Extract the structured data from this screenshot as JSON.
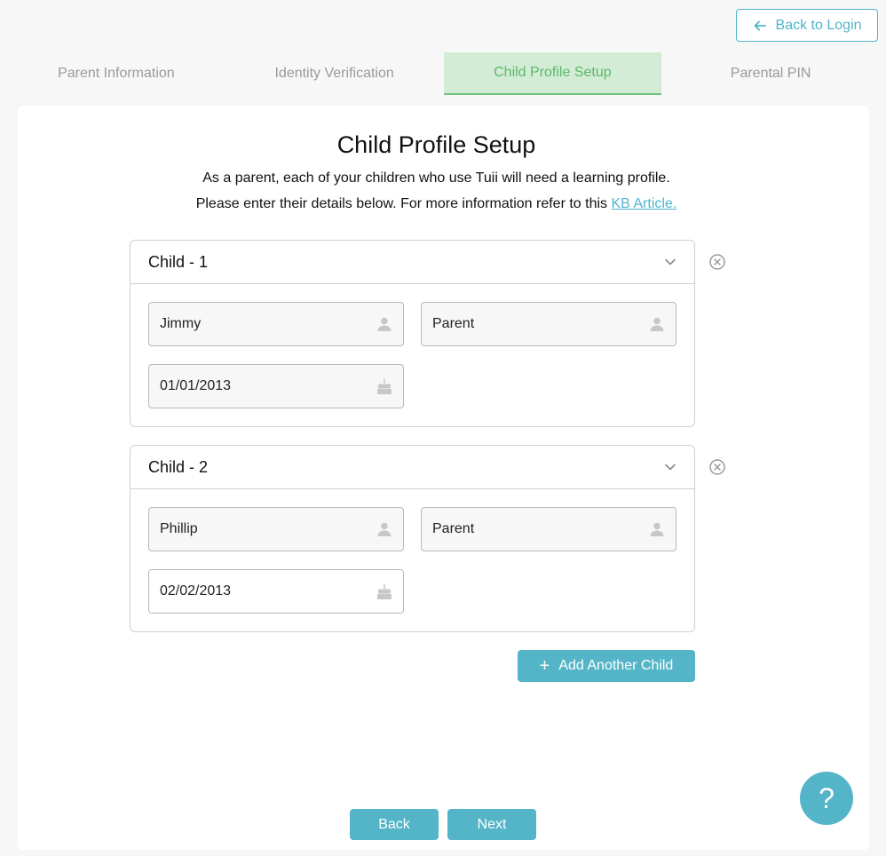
{
  "header": {
    "back_to_login_label": "Back to Login"
  },
  "stepper": {
    "steps": [
      {
        "label": "Parent Information"
      },
      {
        "label": "Identity Verification"
      },
      {
        "label": "Child Profile Setup"
      },
      {
        "label": "Parental PIN"
      }
    ],
    "active_step": "Child Profile Setup"
  },
  "main": {
    "title": "Child Profile Setup",
    "subtitle_line1": "As a parent, each of your children who use Tuii will need a learning profile.",
    "subtitle_line2": "Please enter their details below. For more information refer to this",
    "kb_link_label": "KB Article."
  },
  "children": [
    {
      "header": "Child - 1",
      "first_name": "Jimmy",
      "last_name": "Parent",
      "dob": "01/01/2013"
    },
    {
      "header": "Child - 2",
      "first_name": "Phillip",
      "last_name": "Parent",
      "dob": "02/02/2013"
    }
  ],
  "actions": {
    "add_child_label": "Add Another Child",
    "back_label": "Back",
    "next_label": "Next",
    "help_label": "?"
  },
  "colors": {
    "accent": "#55b5c8",
    "active_step_bg": "#d3ecd5",
    "active_step_text": "#5cb86a"
  }
}
